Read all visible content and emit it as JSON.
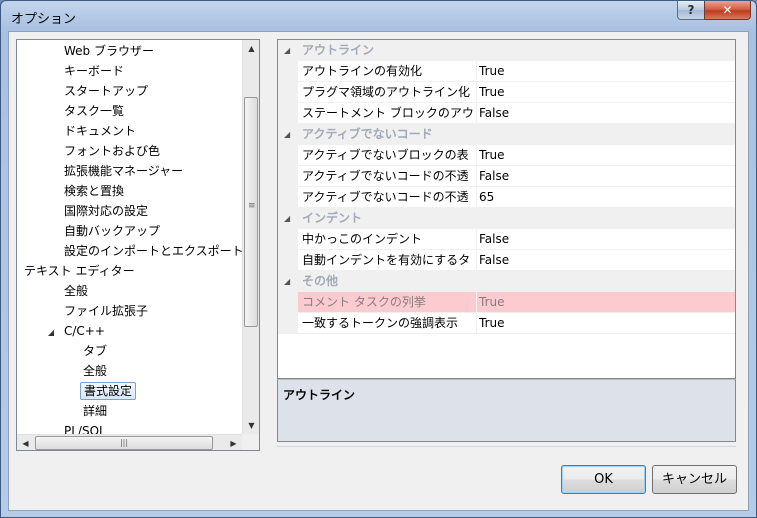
{
  "window": {
    "title": "オプション",
    "help_label": "?",
    "close_label": "✕"
  },
  "tree": {
    "items": [
      {
        "label": "Web ブラウザー",
        "level": 2
      },
      {
        "label": "キーボード",
        "level": 2
      },
      {
        "label": "スタートアップ",
        "level": 2
      },
      {
        "label": "タスク一覧",
        "level": 2
      },
      {
        "label": "ドキュメント",
        "level": 2
      },
      {
        "label": "フォントおよび色",
        "level": 2
      },
      {
        "label": "拡張機能マネージャー",
        "level": 2
      },
      {
        "label": "検索と置換",
        "level": 2
      },
      {
        "label": "国際対応の設定",
        "level": 2
      },
      {
        "label": "自動バックアップ",
        "level": 2
      },
      {
        "label": "設定のインポートとエクスポート",
        "level": 2
      },
      {
        "label": "テキスト エディター",
        "level": 1,
        "expanded": true
      },
      {
        "label": "全般",
        "level": 2
      },
      {
        "label": "ファイル拡張子",
        "level": 2
      },
      {
        "label": "C/C++",
        "level": 2,
        "expanded": true
      },
      {
        "label": "タブ",
        "level": 3
      },
      {
        "label": "全般",
        "level": 3
      },
      {
        "label": "書式設定",
        "level": 3,
        "selected": true
      },
      {
        "label": "詳細",
        "level": 3
      },
      {
        "label": "PL/SQL",
        "level": 2
      }
    ],
    "scroll_grip": "≡",
    "hscroll_grip": "|||"
  },
  "grid": {
    "categories": [
      {
        "name": "アウトライン",
        "props": [
          {
            "name": "アウトラインの有効化",
            "value": "True"
          },
          {
            "name": "プラグマ領域のアウトライン化",
            "value": "True"
          },
          {
            "name": "ステートメント ブロックのアウ",
            "value": "False"
          }
        ]
      },
      {
        "name": "アクティブでないコード",
        "props": [
          {
            "name": "アクティブでないブロックの表",
            "value": "True"
          },
          {
            "name": "アクティブでないコードの不透",
            "value": "False"
          },
          {
            "name": "アクティブでないコードの不透",
            "value": "65"
          }
        ]
      },
      {
        "name": "インデント",
        "props": [
          {
            "name": "中かっこのインデント",
            "value": "False"
          },
          {
            "name": "自動インデントを有効にするタ",
            "value": "False"
          }
        ]
      },
      {
        "name": "その他",
        "props": [
          {
            "name": "コメント タスクの列挙",
            "value": "True",
            "highlighted": true
          },
          {
            "name": "一致するトークンの強調表示",
            "value": "True"
          }
        ]
      }
    ]
  },
  "description": {
    "title": "アウトライン"
  },
  "buttons": {
    "ok": "OK",
    "cancel": "キャンセル"
  },
  "colors": {
    "highlight_row": "#fccbd0",
    "category_text": "#a0aab8"
  }
}
